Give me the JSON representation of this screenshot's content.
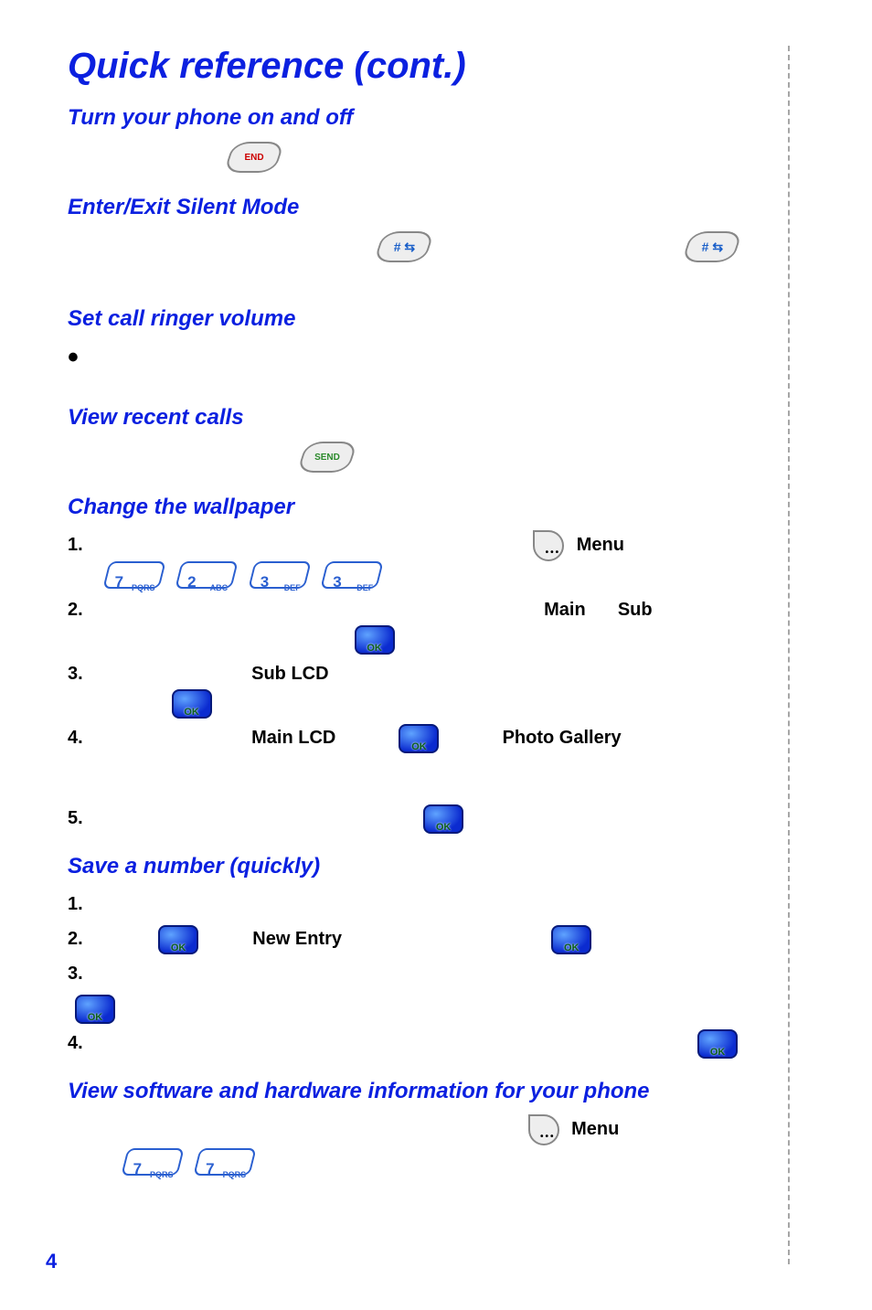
{
  "title": "Quick reference (cont.)",
  "sections": {
    "turn_phone": "Turn your phone on and off",
    "silent_mode": "Enter/Exit Silent Mode",
    "ringer_volume": "Set call ringer volume",
    "recent_calls": "View recent calls",
    "wallpaper": "Change the wallpaper",
    "save_number": "Save a number (quickly)",
    "view_info": "View software and hardware information for your phone"
  },
  "labels": {
    "menu": "Menu",
    "main": "Main",
    "sub": "Sub",
    "sub_lcd": "Sub LCD",
    "main_lcd": "Main LCD",
    "photo_gallery": "Photo Gallery",
    "new_entry": "New Entry"
  },
  "keys": {
    "end": "END",
    "send": "SEND",
    "hash": "# ⇆",
    "ok": "OK",
    "num7": {
      "digit": "7",
      "sub": "PQRS"
    },
    "num2": {
      "digit": "2",
      "sub": "ABC"
    },
    "num3": {
      "digit": "3",
      "sub": "DEF"
    }
  },
  "steps": {
    "wallpaper": [
      "1.",
      "2.",
      "3.",
      "4.",
      "5."
    ],
    "save": [
      "1.",
      "2.",
      "3.",
      "4."
    ]
  },
  "page_number": "4"
}
